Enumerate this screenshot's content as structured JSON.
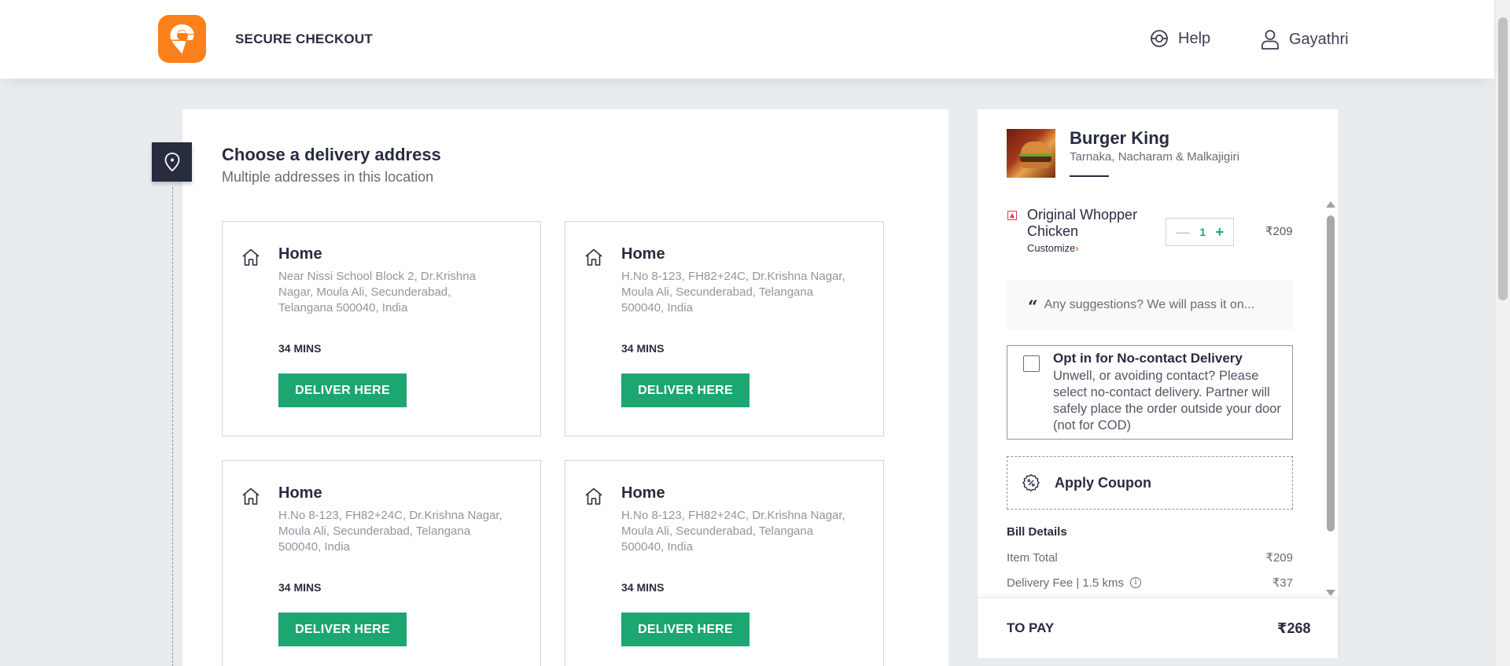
{
  "header": {
    "title": "SECURE CHECKOUT",
    "help_label": "Help",
    "user_name": "Gayathri"
  },
  "colors": {
    "brand": "#fc8019",
    "accent_green": "#1ba672",
    "text_dark": "#282c3f"
  },
  "address_section": {
    "title": "Choose a delivery address",
    "subtitle": "Multiple addresses in this location",
    "addresses": [
      {
        "type": "Home",
        "address": "Near Nissi School Block 2, Dr.Krishna Nagar, Moula Ali, Secunderabad, Telangana 500040, India",
        "eta": "34 MINS",
        "button": "DELIVER HERE"
      },
      {
        "type": "Home",
        "address": "H.No 8-123, FH82+24C, Dr.Krishna Nagar, Moula Ali, Secunderabad, Telangana 500040, India",
        "eta": "34 MINS",
        "button": "DELIVER HERE"
      },
      {
        "type": "Home",
        "address": "H.No 8-123, FH82+24C, Dr.Krishna Nagar, Moula Ali, Secunderabad, Telangana 500040, India",
        "eta": "34 MINS",
        "button": "DELIVER HERE"
      },
      {
        "type": "Home",
        "address": "H.No 8-123, FH82+24C, Dr.Krishna Nagar, Moula Ali, Secunderabad, Telangana 500040, India",
        "eta": "34 MINS",
        "button": "DELIVER HERE"
      }
    ]
  },
  "cart": {
    "restaurant_name": "Burger King",
    "restaurant_location": "Tarnaka, Nacharam & Malkajigiri",
    "item": {
      "name": "Original Whopper Chicken",
      "customize": "Customize",
      "quantity": "1",
      "price": "₹209"
    },
    "suggestion_placeholder": "Any suggestions? We will pass it on...",
    "no_contact": {
      "title": "Opt in for No-contact Delivery",
      "description": "Unwell, or avoiding contact? Please select no-contact delivery. Partner will safely place the order outside your door (not for COD)"
    },
    "coupon_label": "Apply Coupon",
    "bill": {
      "heading": "Bill Details",
      "item_total_label": "Item Total",
      "item_total_value": "₹209",
      "delivery_fee_label": "Delivery Fee | 1.5 kms",
      "delivery_fee_value": "₹37"
    },
    "to_pay_label": "TO PAY",
    "to_pay_value": "₹268"
  }
}
